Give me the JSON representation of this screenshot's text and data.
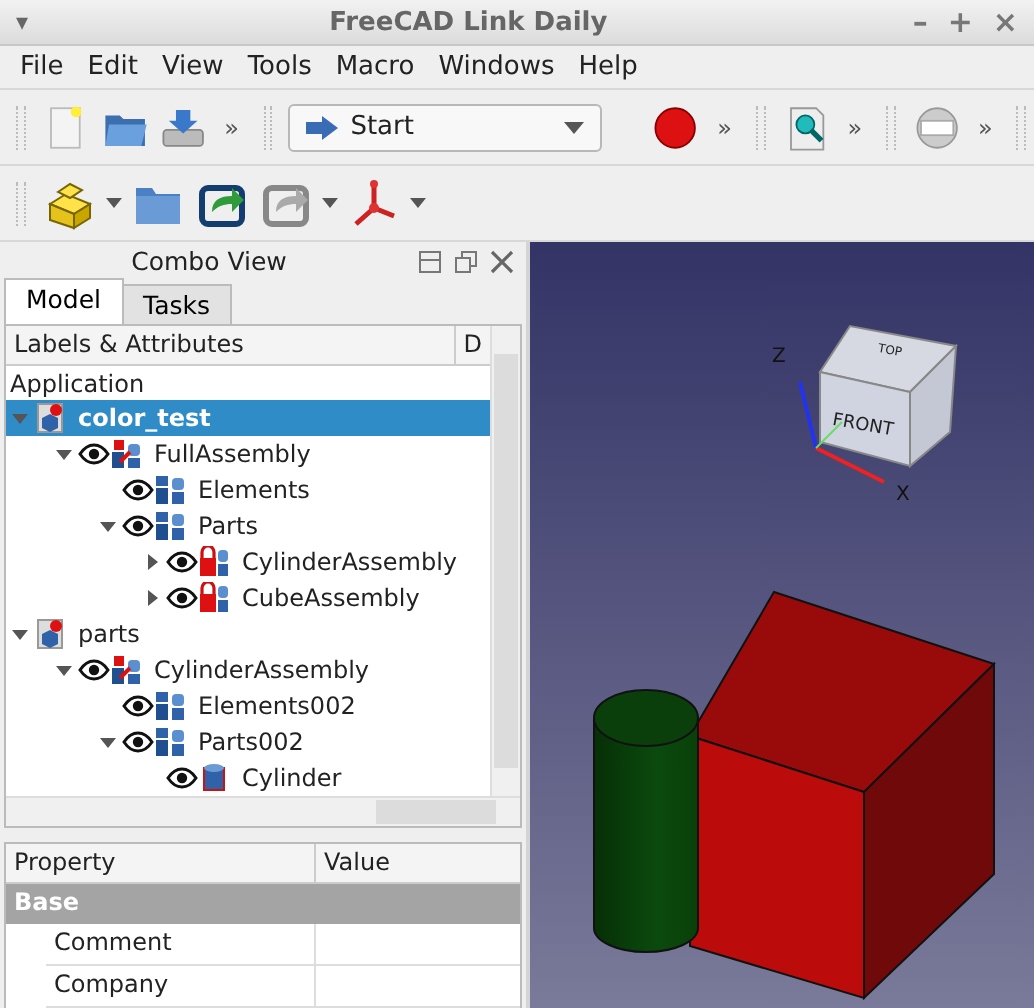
{
  "window": {
    "title": "FreeCAD Link Daily",
    "menu_glyph": "▾",
    "controls": [
      "–",
      "+",
      "×"
    ]
  },
  "menu": [
    "File",
    "Edit",
    "View",
    "Tools",
    "Macro",
    "Windows",
    "Help"
  ],
  "toolbars": [
    [
      {
        "kind": "new"
      },
      {
        "kind": "open"
      },
      {
        "kind": "save"
      },
      {
        "kind": "overflow",
        "text": "»"
      },
      {
        "kind": "combo",
        "text": "Start"
      },
      {
        "kind": "record"
      },
      {
        "kind": "overflow",
        "text": "»"
      },
      {
        "kind": "inspect"
      },
      {
        "kind": "overflow",
        "text": "»"
      },
      {
        "kind": "disc"
      },
      {
        "kind": "overflow",
        "text": "»"
      }
    ],
    [
      {
        "kind": "part",
        "dropdown": true
      },
      {
        "kind": "folder",
        "dropdown": false
      },
      {
        "kind": "link",
        "dropdown": false
      },
      {
        "kind": "link-grey",
        "dropdown": true
      },
      {
        "kind": "axes",
        "dropdown": true
      }
    ]
  ],
  "combo_view": {
    "title": "Combo View",
    "tabs": [
      {
        "label": "Model",
        "selected": true
      },
      {
        "label": "Tasks",
        "selected": false
      }
    ],
    "tree": {
      "columns": [
        "Labels & Attributes",
        "D"
      ],
      "root": "Application",
      "nodes": [
        {
          "label": "color_test",
          "kind": "document",
          "visible": false,
          "selected": true,
          "has_children": true,
          "expanded": true,
          "children": [
            {
              "label": "FullAssembly",
              "kind": "assembly",
              "visible": true,
              "selected": false,
              "has_children": true,
              "expanded": true,
              "children": [
                {
                  "label": "Elements",
                  "kind": "group",
                  "visible": true,
                  "selected": false,
                  "has_children": false,
                  "expanded": false
                },
                {
                  "label": "Parts",
                  "kind": "group",
                  "visible": true,
                  "selected": false,
                  "has_children": true,
                  "expanded": true,
                  "children": [
                    {
                      "label": "CylinderAssembly",
                      "kind": "link",
                      "visible": true,
                      "selected": false,
                      "has_children": true,
                      "expanded": false
                    },
                    {
                      "label": "CubeAssembly",
                      "kind": "link",
                      "visible": true,
                      "selected": false,
                      "has_children": true,
                      "expanded": false
                    }
                  ]
                }
              ]
            }
          ]
        },
        {
          "label": "parts",
          "kind": "document",
          "visible": false,
          "selected": false,
          "has_children": true,
          "expanded": true,
          "children": [
            {
              "label": "CylinderAssembly",
              "kind": "assembly",
              "visible": true,
              "selected": false,
              "has_children": true,
              "expanded": true,
              "children": [
                {
                  "label": "Elements002",
                  "kind": "group",
                  "visible": true,
                  "selected": false,
                  "has_children": false,
                  "expanded": false
                },
                {
                  "label": "Parts002",
                  "kind": "group",
                  "visible": true,
                  "selected": false,
                  "has_children": true,
                  "expanded": true,
                  "children": [
                    {
                      "label": "Cylinder",
                      "kind": "cylinder",
                      "visible": true,
                      "selected": false,
                      "has_children": false,
                      "expanded": false
                    }
                  ]
                }
              ]
            }
          ]
        }
      ]
    },
    "properties": {
      "columns": [
        "Property",
        "Value"
      ],
      "group": "Base",
      "rows": [
        {
          "name": "Comment"
        },
        {
          "name": "Company"
        }
      ]
    }
  },
  "view3d": {
    "nav_cube": {
      "front": "FRONT",
      "top": "TOP"
    },
    "axes": {
      "z": "Z",
      "x": "X"
    }
  }
}
